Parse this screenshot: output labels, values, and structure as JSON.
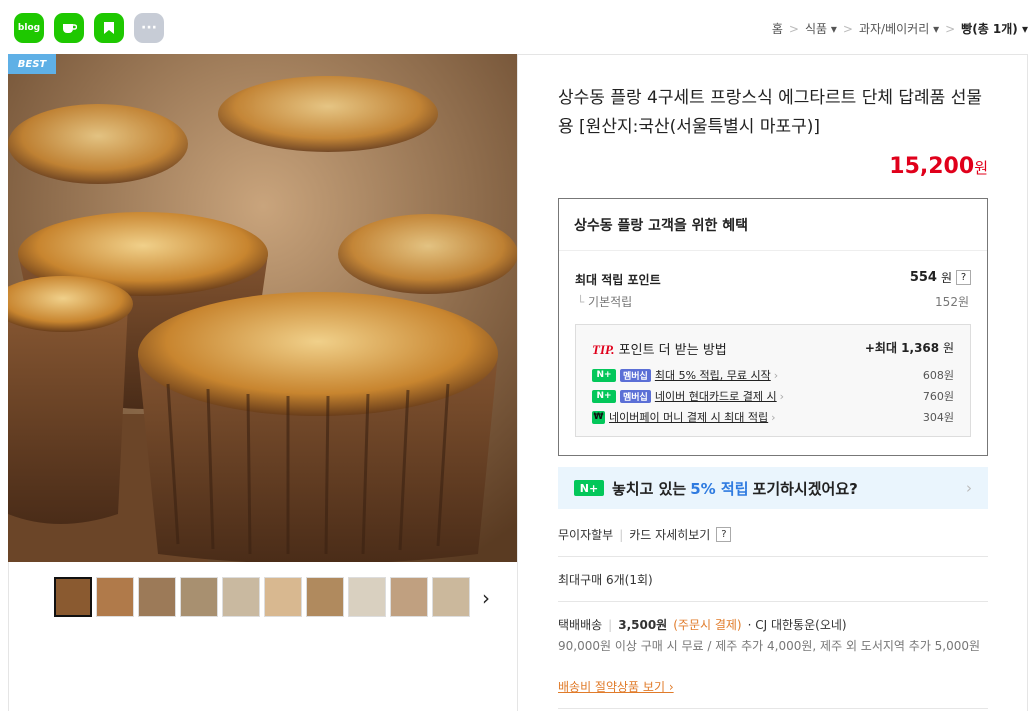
{
  "share_icons": [
    {
      "name": "blog",
      "label": "blog",
      "color": "#1ec800"
    },
    {
      "name": "cafe",
      "label": "",
      "color": "#1ec800"
    },
    {
      "name": "bookmark",
      "label": "",
      "color": "#1ec800"
    },
    {
      "name": "more",
      "label": "···",
      "color": "#c7ccd6"
    }
  ],
  "breadcrumb": {
    "home": "홈",
    "cat1": "식품",
    "cat2": "과자/베이커리",
    "cat3": "빵(총 1개)"
  },
  "product": {
    "badge": "BEST",
    "title": "상수동 플랑 4구세트 프랑스식 에그타르트 단체 답례품 선물용 [원산지:국산(서울특별시 마포구)]",
    "price": "15,200",
    "price_unit": "원"
  },
  "benefit": {
    "title": "상수동 플랑 고객을 위한 혜택",
    "max_point_label": "최대 적립 포인트",
    "max_point_value": "554",
    "max_point_unit": "원",
    "help": "?",
    "basic_label": "기본적립",
    "basic_value": "152원",
    "tip_prefix": "TIP.",
    "tip_label": "포인트 더 받는 방법",
    "tip_max": "+최대 1,368",
    "tip_max_unit": "원",
    "tips": [
      {
        "badge": "멤버십",
        "text": "최대 5% 적립, 무료 시작",
        "value": "608원"
      },
      {
        "badge": "멤버십",
        "text": "네이버 현대카드로 결제 시",
        "value": "760원"
      },
      {
        "badge": "",
        "text": "네이버페이 머니 결제 시 최대 적립",
        "value": "304원"
      }
    ]
  },
  "banner": {
    "pre": "놓치고 있는 ",
    "highlight": "5% 적립",
    "post": " 포기하시겠어요?"
  },
  "installment": {
    "label": "무이자할부",
    "card": "카드 자세히보기",
    "help": "?"
  },
  "max_buy": "최대구매 6개(1회)",
  "shipping": {
    "label": "택배배송",
    "fee": "3,500원",
    "note": "(주문시 결제)",
    "courier": "· CJ 대한통운(오네)",
    "detail": "90,000원 이상 구매 시 무료 / 제주 추가 4,000원, 제주 외 도서지역 추가 5,000원",
    "link": "배송비 절약상품 보기"
  },
  "colors": {
    "accent": "#e0001b",
    "naver": "#03c75a",
    "link": "#e07b2a"
  }
}
